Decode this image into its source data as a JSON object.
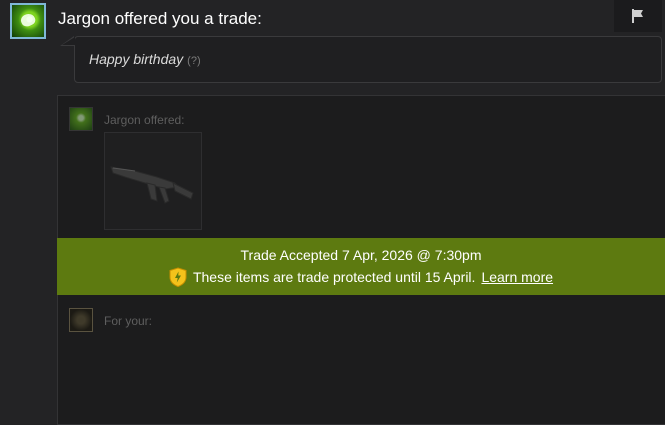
{
  "header": {
    "title": "Jargon offered you a trade:"
  },
  "message": {
    "text": "Happy birthday",
    "help": "(?)"
  },
  "offer": {
    "sender_label": "Jargon offered:",
    "receiver_label": "For your:",
    "item_icon": "rifle-icon"
  },
  "banner": {
    "accepted_text": "Trade Accepted 7 Apr, 2026 @ 7:30pm",
    "protected_text": "These items are trade protected until 15 April.",
    "learn_more": "Learn more",
    "color": "#5d7a10"
  },
  "icons": {
    "flag": "flag-icon",
    "shield": "trade-protection-shield-icon"
  }
}
